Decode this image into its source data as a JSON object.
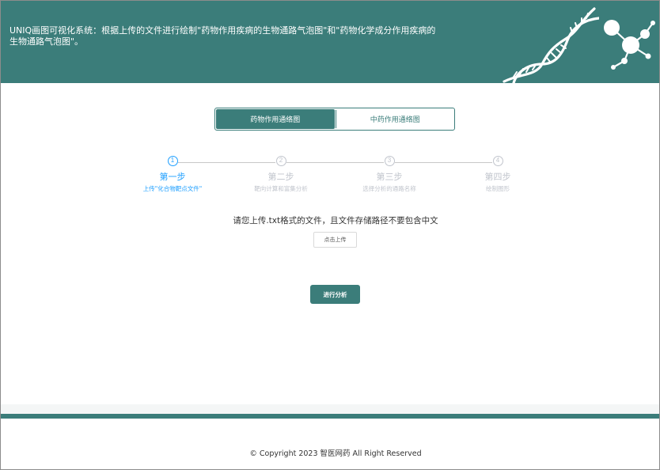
{
  "header": {
    "title": "UNIQ画图可视化系统：根据上传的文件进行绘制\"药物作用疾病的生物通路气泡图\"和\"药物化学成分作用疾病的生物通路气泡图\"。"
  },
  "tabs": [
    {
      "label": "药物作用通络图",
      "active": true
    },
    {
      "label": "中药作用通络图",
      "active": false
    }
  ],
  "steps": [
    {
      "number": "1",
      "title": "第一步",
      "description": "上传\"化合物靶点文件\"",
      "active": true
    },
    {
      "number": "2",
      "title": "第二步",
      "description": "靶向计算和富集分析",
      "active": false
    },
    {
      "number": "3",
      "title": "第三步",
      "description": "选择分析的通路名称",
      "active": false
    },
    {
      "number": "4",
      "title": "第四步",
      "description": "绘制图形",
      "active": false
    }
  ],
  "upload": {
    "hint": "请您上传.txt格式的文件，且文件存储路径不要包含中文",
    "button_label": "点击上传"
  },
  "analyze_label": "进行分析",
  "footer": {
    "copyright": "© Copyright 2023 智医网药 All Right Reserved"
  },
  "colors": {
    "brand": "#3b7d7a",
    "step_active": "#1e9fff",
    "step_inactive": "#c0c4cc"
  }
}
